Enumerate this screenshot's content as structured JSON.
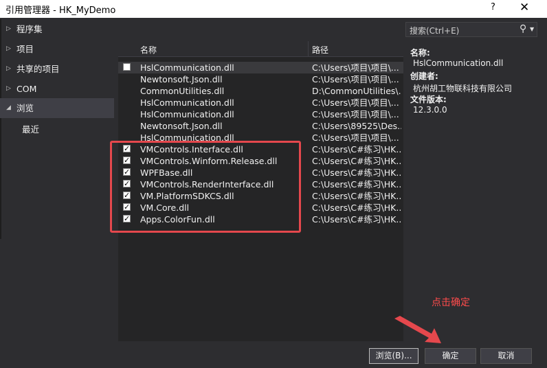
{
  "window": {
    "title": "引用管理器 - HK_MyDemo",
    "help": "?",
    "close": "✕"
  },
  "nav": [
    {
      "label": "程序集",
      "arrow": "▷"
    },
    {
      "label": "项目",
      "arrow": "▷"
    },
    {
      "label": "共享的项目",
      "arrow": "▷"
    },
    {
      "label": "COM",
      "arrow": "▷"
    },
    {
      "label": "浏览",
      "arrow": "◢"
    },
    {
      "label": "最近",
      "arrow": ""
    }
  ],
  "list": {
    "header": {
      "name": "名称",
      "path": "路径"
    },
    "rows": [
      {
        "name": "HslCommunication.dll",
        "path": "C:\\Users\\项目\\项目\\...",
        "checked": false,
        "show_checkbox": true
      },
      {
        "name": "Newtonsoft.Json.dll",
        "path": "C:\\Users\\项目\\项目\\...",
        "checked": false,
        "show_checkbox": false
      },
      {
        "name": "CommonUtilities.dll",
        "path": "D:\\CommonUtilities\\...",
        "checked": false,
        "show_checkbox": false
      },
      {
        "name": "HslCommunication.dll",
        "path": "C:\\Users\\项目\\项目\\...",
        "checked": false,
        "show_checkbox": false
      },
      {
        "name": "HslCommunication.dll",
        "path": "C:\\Users\\项目\\项目\\...",
        "checked": false,
        "show_checkbox": false
      },
      {
        "name": "Newtonsoft.Json.dll",
        "path": "C:\\Users\\89525\\Des...",
        "checked": false,
        "show_checkbox": false
      },
      {
        "name": "HslCommunication.dll",
        "path": "C:\\Users\\项目\\项目\\...",
        "checked": false,
        "show_checkbox": false
      },
      {
        "name": "VMControls.Interface.dll",
        "path": "C:\\Users\\C#练习\\HK...",
        "checked": true,
        "show_checkbox": true
      },
      {
        "name": "VMControls.Winform.Release.dll",
        "path": "C:\\Users\\C#练习\\HK...",
        "checked": true,
        "show_checkbox": true
      },
      {
        "name": "WPFBase.dll",
        "path": "C:\\Users\\C#练习\\HK...",
        "checked": true,
        "show_checkbox": true
      },
      {
        "name": "VMControls.RenderInterface.dll",
        "path": "C:\\Users\\C#练习\\HK...",
        "checked": true,
        "show_checkbox": true
      },
      {
        "name": "VM.PlatformSDKCS.dll",
        "path": "C:\\Users\\C#练习\\HK...",
        "checked": true,
        "show_checkbox": true
      },
      {
        "name": "VM.Core.dll",
        "path": "C:\\Users\\C#练习\\HK...",
        "checked": true,
        "show_checkbox": true
      },
      {
        "name": "Apps.ColorFun.dll",
        "path": "C:\\Users\\C#练习\\HK...",
        "checked": true,
        "show_checkbox": true
      }
    ]
  },
  "search": {
    "placeholder": "搜索(Ctrl+E)",
    "icon": "search-icon"
  },
  "details": {
    "name_label": "名称:",
    "name_value": "HslCommunication.dll",
    "creator_label": "创建者:",
    "creator_value": "杭州胡工物联科技有限公司",
    "version_label": "文件版本:",
    "version_value": "12.3.0.0"
  },
  "annotation": {
    "text": "点击确定",
    "color": "#ff4b4b"
  },
  "buttons": {
    "browse": "浏览(B)...",
    "ok": "确定",
    "cancel": "取消"
  },
  "colors": {
    "background": "#2d2d30",
    "list_bg": "#252526",
    "highlight_box": "#e5484d"
  }
}
